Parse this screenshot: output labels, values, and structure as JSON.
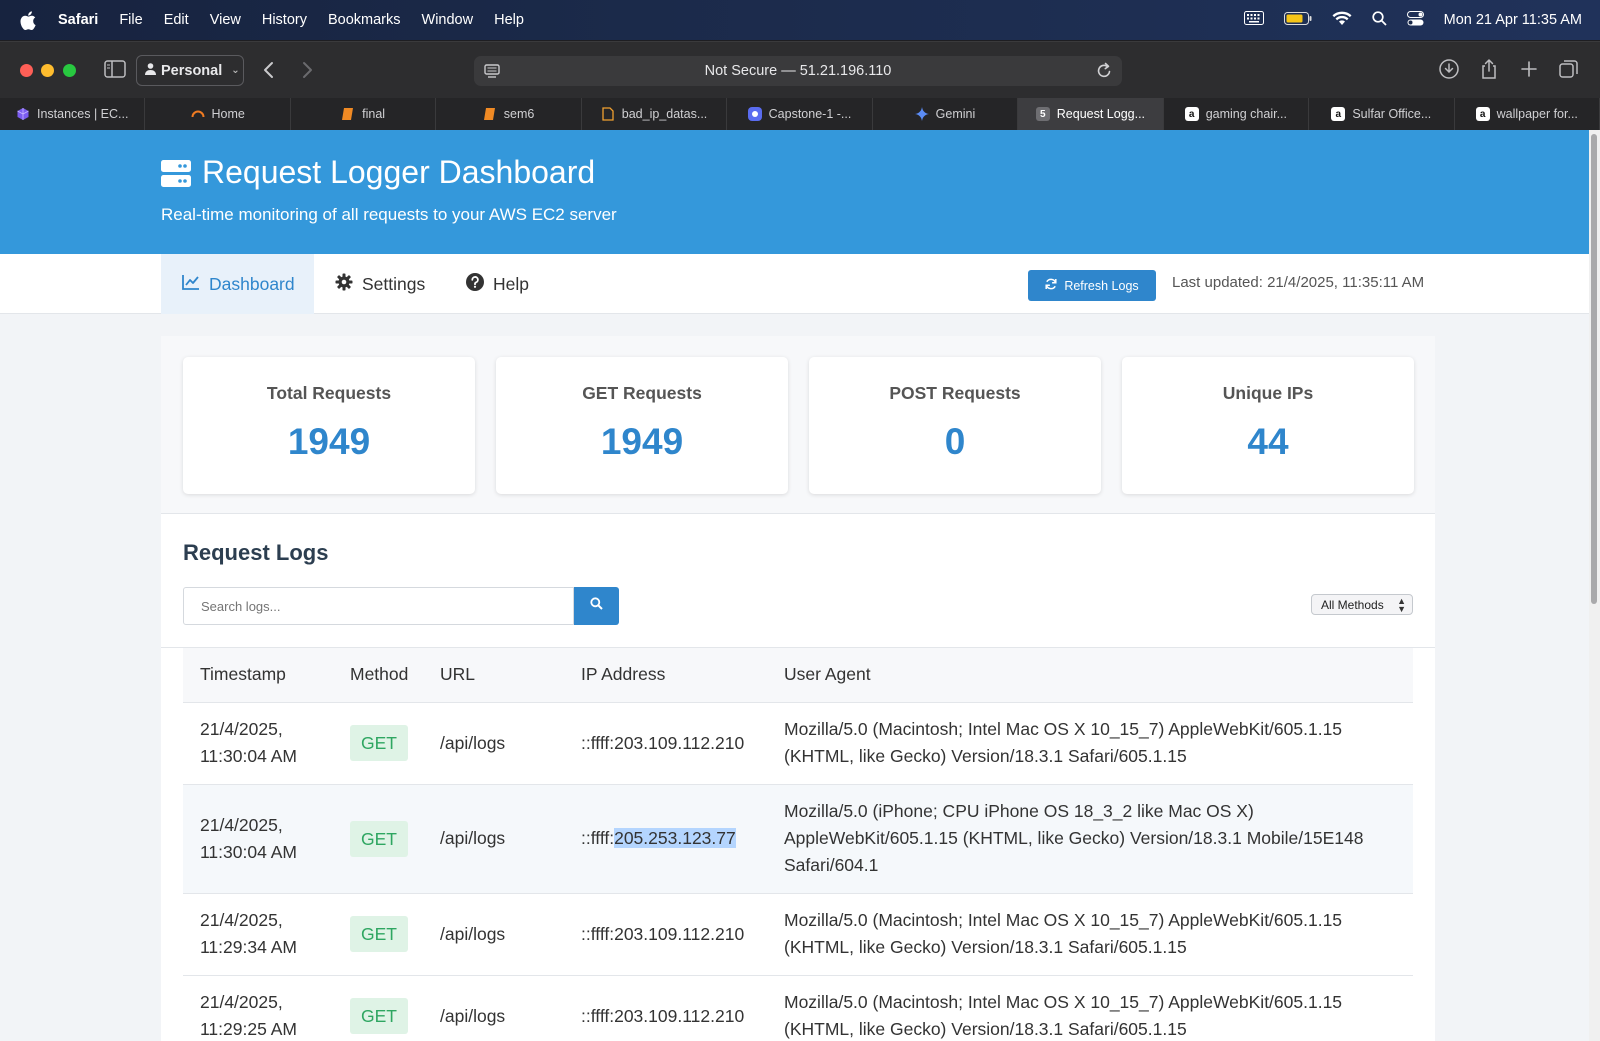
{
  "menubar": {
    "app": "Safari",
    "items": [
      "File",
      "Edit",
      "View",
      "History",
      "Bookmarks",
      "Window",
      "Help"
    ],
    "clock": "Mon 21 Apr  11:35 AM"
  },
  "toolbar": {
    "profile": "Personal",
    "address": "Not Secure — 51.21.196.110"
  },
  "tabs": [
    {
      "label": "Instances | EC...",
      "icon": "aws-cube-icon",
      "color": "#7b5cf0"
    },
    {
      "label": "Home",
      "icon": "home-arc-icon",
      "color": "#f07b22"
    },
    {
      "label": "final",
      "icon": "book-icon",
      "color": "#f08a24"
    },
    {
      "label": "sem6",
      "icon": "book-icon",
      "color": "#f08a24"
    },
    {
      "label": "bad_ip_datas...",
      "icon": "document-icon",
      "color": "#f0a030"
    },
    {
      "label": "Capstone-1 -...",
      "icon": "app-icon",
      "color": "#5a6cf0"
    },
    {
      "label": "Gemini",
      "icon": "gemini-star-icon",
      "color": "#5b8cf5"
    },
    {
      "label": "Request Logg...",
      "icon": "number-icon",
      "badge": "5",
      "color": "#6e6e72"
    },
    {
      "label": "gaming chair...",
      "icon": "amazon-icon",
      "badge": "a",
      "color": "#ffffff"
    },
    {
      "label": "Sulfar Office...",
      "icon": "amazon-icon",
      "badge": "a",
      "color": "#ffffff"
    },
    {
      "label": "wallpaper for...",
      "icon": "amazon-icon",
      "badge": "a",
      "color": "#ffffff"
    }
  ],
  "header": {
    "title": "Request Logger Dashboard",
    "subtitle": "Real-time monitoring of all requests to your AWS EC2 server"
  },
  "nav": {
    "dashboard": "Dashboard",
    "settings": "Settings",
    "help": "Help",
    "refresh": "Refresh Logs",
    "last_updated": "Last updated: 21/4/2025, 11:35:11 AM"
  },
  "stats": [
    {
      "label": "Total Requests",
      "value": "1949"
    },
    {
      "label": "GET Requests",
      "value": "1949"
    },
    {
      "label": "POST Requests",
      "value": "0"
    },
    {
      "label": "Unique IPs",
      "value": "44"
    }
  ],
  "logs": {
    "title": "Request Logs",
    "search_placeholder": "Search logs...",
    "method_filter": "All Methods",
    "columns": [
      "Timestamp",
      "Method",
      "URL",
      "IP Address",
      "User Agent"
    ],
    "rows": [
      {
        "date": "21/4/2025,",
        "time": "11:30:04 AM",
        "method": "GET",
        "url": "/api/logs",
        "ip_prefix": "::ffff:",
        "ip": "203.109.112.210",
        "ua": [
          "Mozilla/5.0 (Macintosh; Intel Mac OS X 10_15_7) AppleWebKit/605.1.15",
          "(KHTML, like Gecko) Version/18.3.1 Safari/605.1.15"
        ]
      },
      {
        "date": "21/4/2025,",
        "time": "11:30:04 AM",
        "method": "GET",
        "url": "/api/logs",
        "ip_prefix": "::ffff:",
        "ip": "205.253.123.77",
        "ua": [
          "Mozilla/5.0 (iPhone; CPU iPhone OS 18_3_2 like Mac OS X)",
          "AppleWebKit/605.1.15 (KHTML, like Gecko) Version/18.3.1 Mobile/15E148",
          "Safari/604.1"
        ]
      },
      {
        "date": "21/4/2025,",
        "time": "11:29:34 AM",
        "method": "GET",
        "url": "/api/logs",
        "ip_prefix": "::ffff:",
        "ip": "203.109.112.210",
        "ua": [
          "Mozilla/5.0 (Macintosh; Intel Mac OS X 10_15_7) AppleWebKit/605.1.15",
          "(KHTML, like Gecko) Version/18.3.1 Safari/605.1.15"
        ]
      },
      {
        "date": "21/4/2025,",
        "time": "11:29:25 AM",
        "method": "GET",
        "url": "/api/logs",
        "ip_prefix": "::ffff:",
        "ip": "203.109.112.210",
        "ua": [
          "Mozilla/5.0 (Macintosh; Intel Mac OS X 10_15_7) AppleWebKit/605.1.15",
          "(KHTML, like Gecko) Version/18.3.1 Safari/605.1.15"
        ]
      }
    ]
  },
  "colors": {
    "accent": "#3498db",
    "button": "#2f86cc",
    "get_badge_bg": "#dff3e6",
    "get_badge_text": "#2ea661"
  }
}
